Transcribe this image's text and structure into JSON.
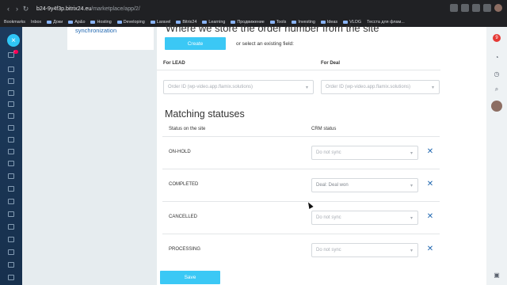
{
  "browser": {
    "url_host": "b24-9y4f3p.bitrix24.eu",
    "url_path": "/marketplace/app/2/",
    "bookmarks": [
      "Bookmarks",
      "Inbox",
      "Доки",
      "Ар&о",
      "Hosting",
      "Developing",
      "Laravel",
      "Bitrix24",
      "Learning",
      "Продвижение",
      "Tools",
      "Investing",
      "Ideas",
      "VLOG",
      "Тесста для флам..."
    ]
  },
  "sidebar": {
    "close_symbol": "×",
    "badge": "7"
  },
  "right_rail": {
    "badge": "9"
  },
  "info_card": {
    "text": "synchronization"
  },
  "order_number": {
    "title": "Where we store the order number from the site",
    "create_label": "Create",
    "or_select_label": "or select an existing field:",
    "lead_header": "For LEAD",
    "deal_header": "For Deal",
    "lead_field": "Order ID (wp-video.app.flamix.solutions)",
    "deal_field": "Order ID (wp-video.app.flamix.solutions)"
  },
  "matching": {
    "title": "Matching statuses",
    "col_site": "Status on the site",
    "col_crm": "CRM status",
    "rows": [
      {
        "site": "ON-HOLD",
        "crm": "Do not sync"
      },
      {
        "site": "COMPLETED",
        "crm": "Deal: Deal won"
      },
      {
        "site": "CANCELLED",
        "crm": "Do not sync"
      },
      {
        "site": "PROCESSING",
        "crm": "Do not sync"
      }
    ]
  },
  "save_label": "Save",
  "icons": {
    "delete": "close-icon",
    "dropdown": "chevron-down-icon"
  },
  "colors": {
    "accent": "#3bc8f5",
    "link": "#2067b0",
    "sidebar": "#1d3a5c"
  }
}
